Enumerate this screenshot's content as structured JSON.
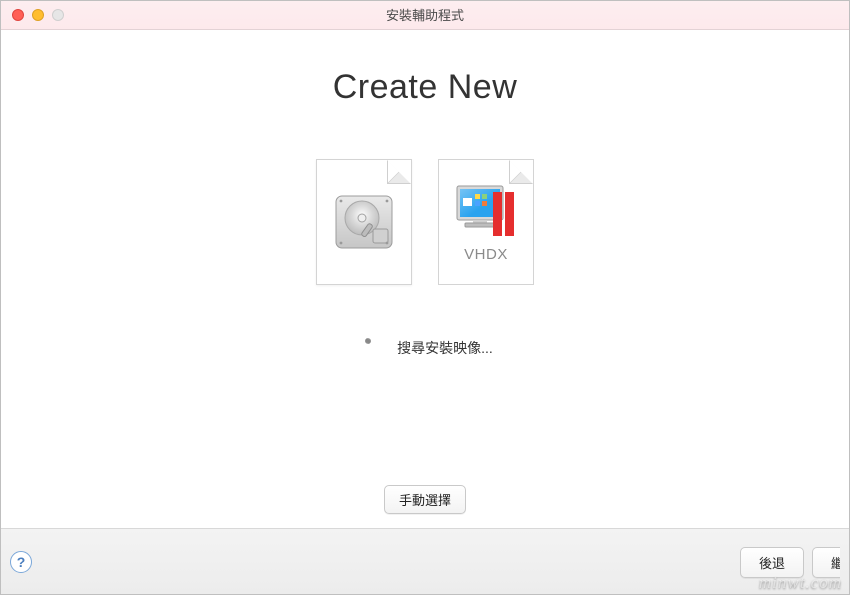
{
  "window": {
    "title": "安裝輔助程式"
  },
  "heading": "Create New",
  "tiles": {
    "hdd_label": "",
    "vhdx_label": "VHDX"
  },
  "status": {
    "text": "搜尋安裝映像..."
  },
  "buttons": {
    "manual": "手動選擇",
    "back": "後退",
    "continue": "繼續"
  },
  "help_glyph": "?",
  "watermark": "minwt.com"
}
